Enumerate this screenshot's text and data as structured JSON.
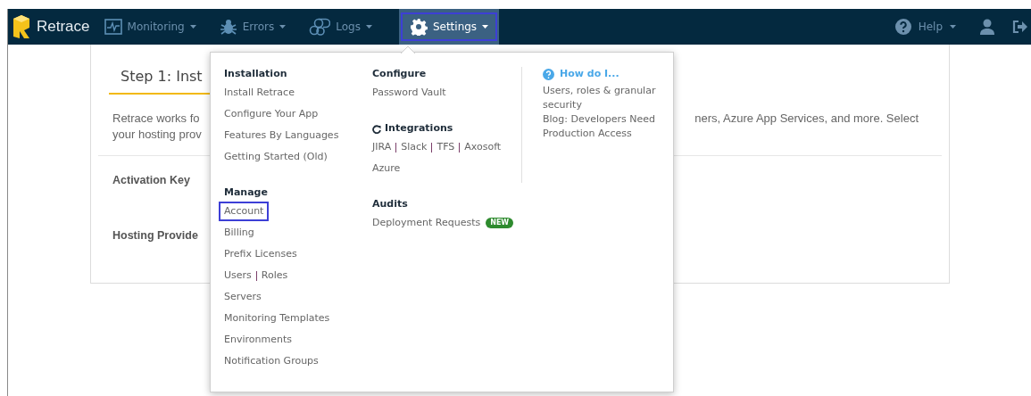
{
  "nav": {
    "brand": "Retrace",
    "items": [
      {
        "label": "Monitoring",
        "selected": false
      },
      {
        "label": "Errors",
        "selected": false
      },
      {
        "label": "Logs",
        "selected": false
      },
      {
        "label": "Settings",
        "selected": true
      }
    ],
    "help": "Help"
  },
  "page": {
    "step_title": "Step 1: Inst",
    "description_left": [
      "Retrace works fo",
      "your hosting prov"
    ],
    "description_right": "ners, Azure App Services, and more. Select",
    "sections": [
      "Activation Key",
      "Hosting Provide"
    ]
  },
  "menu": {
    "columns": [
      {
        "groups": [
          {
            "title": "Installation",
            "items": [
              {
                "links": [
                  "Install Retrace"
                ],
                "selected": false
              },
              {
                "links": [
                  "Configure Your App"
                ],
                "selected": false
              },
              {
                "links": [
                  "Features By Languages"
                ],
                "selected": false
              },
              {
                "links": [
                  "Getting Started (Old)"
                ],
                "selected": false
              }
            ]
          },
          {
            "title": "Manage",
            "items": [
              {
                "links": [
                  "Account"
                ],
                "selected": true
              },
              {
                "links": [
                  "Billing"
                ],
                "selected": false
              },
              {
                "links": [
                  "Prefix Licenses"
                ],
                "selected": false
              },
              {
                "links": [
                  "Users",
                  "Roles"
                ],
                "selected": false
              },
              {
                "links": [
                  "Servers"
                ],
                "selected": false
              },
              {
                "links": [
                  "Monitoring Templates"
                ],
                "selected": false
              },
              {
                "links": [
                  "Environments"
                ],
                "selected": false
              },
              {
                "links": [
                  "Notification Groups"
                ],
                "selected": false
              }
            ]
          }
        ]
      },
      {
        "groups": [
          {
            "title": "Configure",
            "items": [
              {
                "links": [
                  "Password Vault"
                ],
                "selected": false
              }
            ]
          },
          {
            "title": "Integrations",
            "items": [
              {
                "links": [
                  "JIRA",
                  "Slack",
                  "TFS",
                  "Axosoft"
                ],
                "selected": false
              },
              {
                "links": [
                  "Azure"
                ],
                "selected": false
              }
            ]
          },
          {
            "title": "Audits",
            "items": [
              {
                "links": [
                  "Deployment Requests"
                ],
                "badge": "NEW",
                "selected": false
              }
            ]
          }
        ]
      }
    ],
    "how_do_i": {
      "title": "How do I...",
      "links": [
        "Users, roles & granular security",
        "Blog: Developers Need Production Access"
      ]
    }
  }
}
